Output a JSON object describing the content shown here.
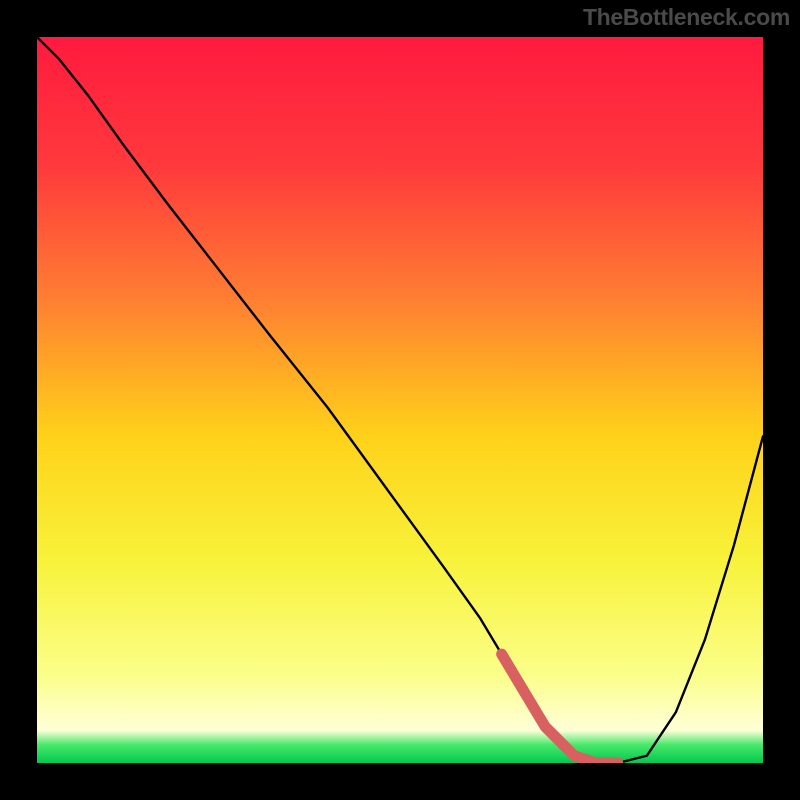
{
  "watermark": "TheBottleneck.com",
  "chart_data": {
    "type": "line",
    "title": "",
    "xlabel": "",
    "ylabel": "",
    "xlim": [
      0,
      100
    ],
    "ylim": [
      0,
      100
    ],
    "x": [
      0,
      3,
      7,
      12,
      18,
      25,
      32,
      40,
      48,
      56,
      61,
      64,
      67,
      70,
      74,
      77,
      80,
      84,
      88,
      92,
      96,
      100
    ],
    "values": [
      100,
      97,
      92,
      85,
      77,
      68,
      59,
      49,
      38,
      27,
      20,
      15,
      10,
      5,
      1,
      0,
      0,
      1,
      7,
      17,
      30,
      45
    ],
    "gradient_stops": [
      {
        "offset": 0.0,
        "color": "#ff1a3f"
      },
      {
        "offset": 0.18,
        "color": "#ff3a3c"
      },
      {
        "offset": 0.35,
        "color": "#ff7a33"
      },
      {
        "offset": 0.55,
        "color": "#ffd21a"
      },
      {
        "offset": 0.72,
        "color": "#f8f23a"
      },
      {
        "offset": 0.88,
        "color": "#fbff8a"
      },
      {
        "offset": 0.955,
        "color": "#ffffd8"
      },
      {
        "offset": 0.975,
        "color": "#48e86a"
      },
      {
        "offset": 1.0,
        "color": "#00c94f"
      }
    ],
    "highlight": {
      "color": "#d96060",
      "x_range": [
        64,
        80
      ]
    }
  }
}
